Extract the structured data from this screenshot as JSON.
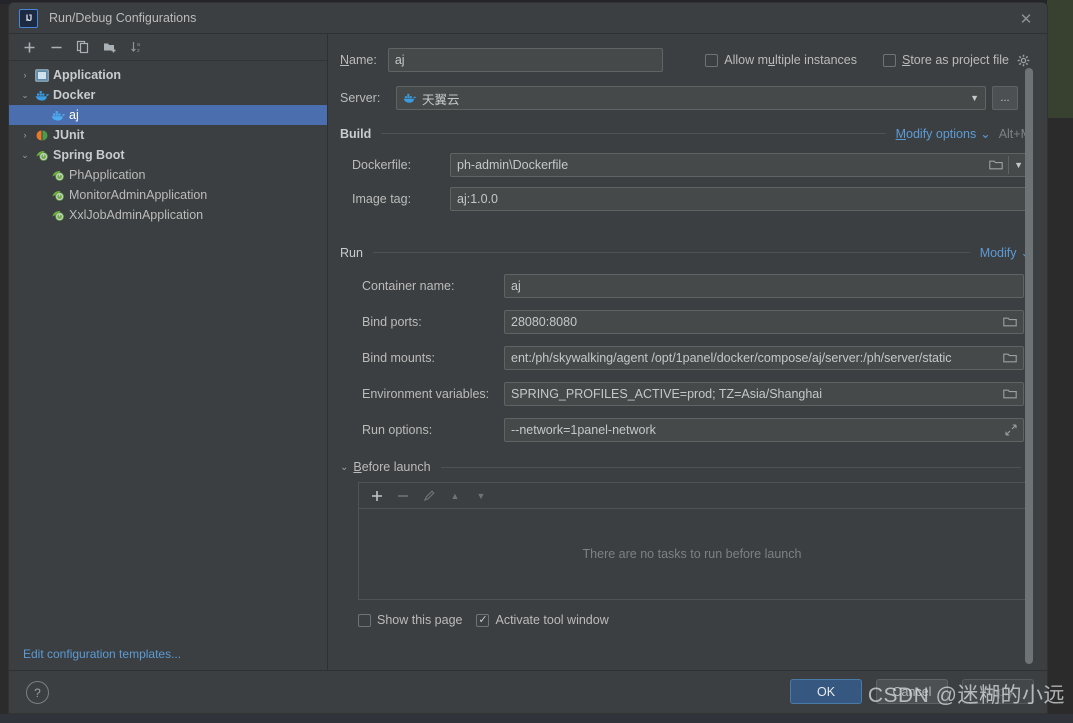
{
  "window": {
    "title": "Run/Debug Configurations",
    "app_icon": "intellij-idea-icon",
    "close_icon": "close-icon"
  },
  "sidebar": {
    "toolbar": [
      {
        "name": "add-configuration-button",
        "icon": "plus-icon",
        "glyph": "+"
      },
      {
        "name": "remove-configuration-button",
        "icon": "minus-icon",
        "glyph": "−"
      },
      {
        "name": "copy-configuration-button",
        "icon": "copy-icon",
        "glyph": "copy"
      },
      {
        "name": "new-folder-button",
        "icon": "folder-add-icon",
        "glyph": "folder"
      },
      {
        "name": "sort-configurations-button",
        "icon": "sort-alphabetically-icon",
        "glyph": "sort"
      }
    ],
    "tree": [
      {
        "label": "Application",
        "type": "group",
        "icon": "application-icon",
        "expanded": false,
        "twist": "›",
        "selected": false
      },
      {
        "label": "Docker",
        "type": "group",
        "icon": "docker-icon",
        "expanded": true,
        "twist": "⌄",
        "selected": false
      },
      {
        "label": "aj",
        "type": "leaf",
        "icon": "docker-icon",
        "twist": "",
        "selected": true
      },
      {
        "label": "JUnit",
        "type": "group",
        "icon": "junit-icon",
        "expanded": false,
        "twist": "›",
        "selected": false
      },
      {
        "label": "Spring Boot",
        "type": "group",
        "icon": "spring-boot-icon",
        "expanded": true,
        "twist": "⌄",
        "selected": false
      },
      {
        "label": "PhApplication",
        "type": "leaf",
        "icon": "spring-boot-icon",
        "twist": "",
        "selected": false
      },
      {
        "label": "MonitorAdminApplication",
        "type": "leaf",
        "icon": "spring-boot-icon",
        "twist": "",
        "selected": false
      },
      {
        "label": "XxlJobAdminApplication",
        "type": "leaf",
        "icon": "spring-boot-icon",
        "twist": "",
        "selected": false
      }
    ],
    "edit_templates_link": "Edit configuration templates..."
  },
  "form": {
    "name_label": "Name:",
    "name_value": "aj",
    "allow_multiple_instances": {
      "label": "Allow multiple instances",
      "checked": false
    },
    "store_as_project_file": {
      "label": "Store as project file",
      "checked": false,
      "gear_icon": "gear-icon"
    },
    "server_label": "Server:",
    "server_value": "天翼云",
    "server_icon": "docker-icon",
    "server_dropdown_icon": "chevron-down-icon",
    "server_browse_label": "...",
    "build_section": {
      "title": "Build",
      "modify_options_link": "Modify options",
      "modify_options_chevron": "⌄",
      "modify_options_shortcut": "Alt+M",
      "dockerfile_label": "Dockerfile:",
      "dockerfile_value": "ph-admin\\Dockerfile",
      "dockerfile_browse_icon": "folder-icon",
      "dockerfile_dropdown_icon": "chevron-down-icon",
      "image_tag_label": "Image tag:",
      "image_tag_value": "aj:1.0.0"
    },
    "run_section": {
      "title": "Run",
      "modify_link": "Modify",
      "modify_chevron": "⌄",
      "fields": [
        {
          "label": "Container name:",
          "value": "aj",
          "trailing_icon": "none"
        },
        {
          "label": "Bind ports:",
          "value": "28080:8080",
          "trailing_icon": "folder-icon"
        },
        {
          "label": "Bind mounts:",
          "value": "ent:/ph/skywalking/agent  /opt/1panel/docker/compose/aj/server:/ph/server/static",
          "trailing_icon": "folder-icon"
        },
        {
          "label": "Environment variables:",
          "value": "SPRING_PROFILES_ACTIVE=prod; TZ=Asia/Shanghai",
          "trailing_icon": "folder-icon"
        },
        {
          "label": "Run options:",
          "value": "--network=1panel-network",
          "trailing_icon": "expand-icon"
        }
      ]
    },
    "before_launch": {
      "title": "Before launch",
      "twist": "⌄",
      "toolbar": [
        {
          "name": "add-task-button",
          "icon": "plus-icon",
          "glyph": "+",
          "enabled": true
        },
        {
          "name": "remove-task-button",
          "icon": "minus-icon",
          "glyph": "−",
          "enabled": false
        },
        {
          "name": "edit-task-button",
          "icon": "pencil-icon",
          "glyph": "pencil",
          "enabled": false
        },
        {
          "name": "move-task-up-button",
          "icon": "arrow-up-icon",
          "glyph": "▲",
          "enabled": false
        },
        {
          "name": "move-task-down-button",
          "icon": "arrow-down-icon",
          "glyph": "▼",
          "enabled": false
        }
      ],
      "empty_text": "There are no tasks to run before launch"
    },
    "show_this_page": {
      "label": "Show this page",
      "checked": false
    },
    "activate_tool_window": {
      "label": "Activate tool window",
      "checked": true
    }
  },
  "footer": {
    "help_icon": "question-mark-icon",
    "ok_label": "OK",
    "cancel_label": "Cancel",
    "apply_label": "Apply"
  },
  "watermark": "CSDN @迷糊的小远",
  "colors": {
    "dialog_bg": "#3c3f41",
    "field_bg": "#45494a",
    "selection_blue": "#4b6eaf",
    "link_blue": "#5b9bd5",
    "ok_button": "#365880",
    "docker_blue": "#3a9ce2",
    "spring_green": "#6cad3f",
    "junit_orange": "#e8792b"
  }
}
